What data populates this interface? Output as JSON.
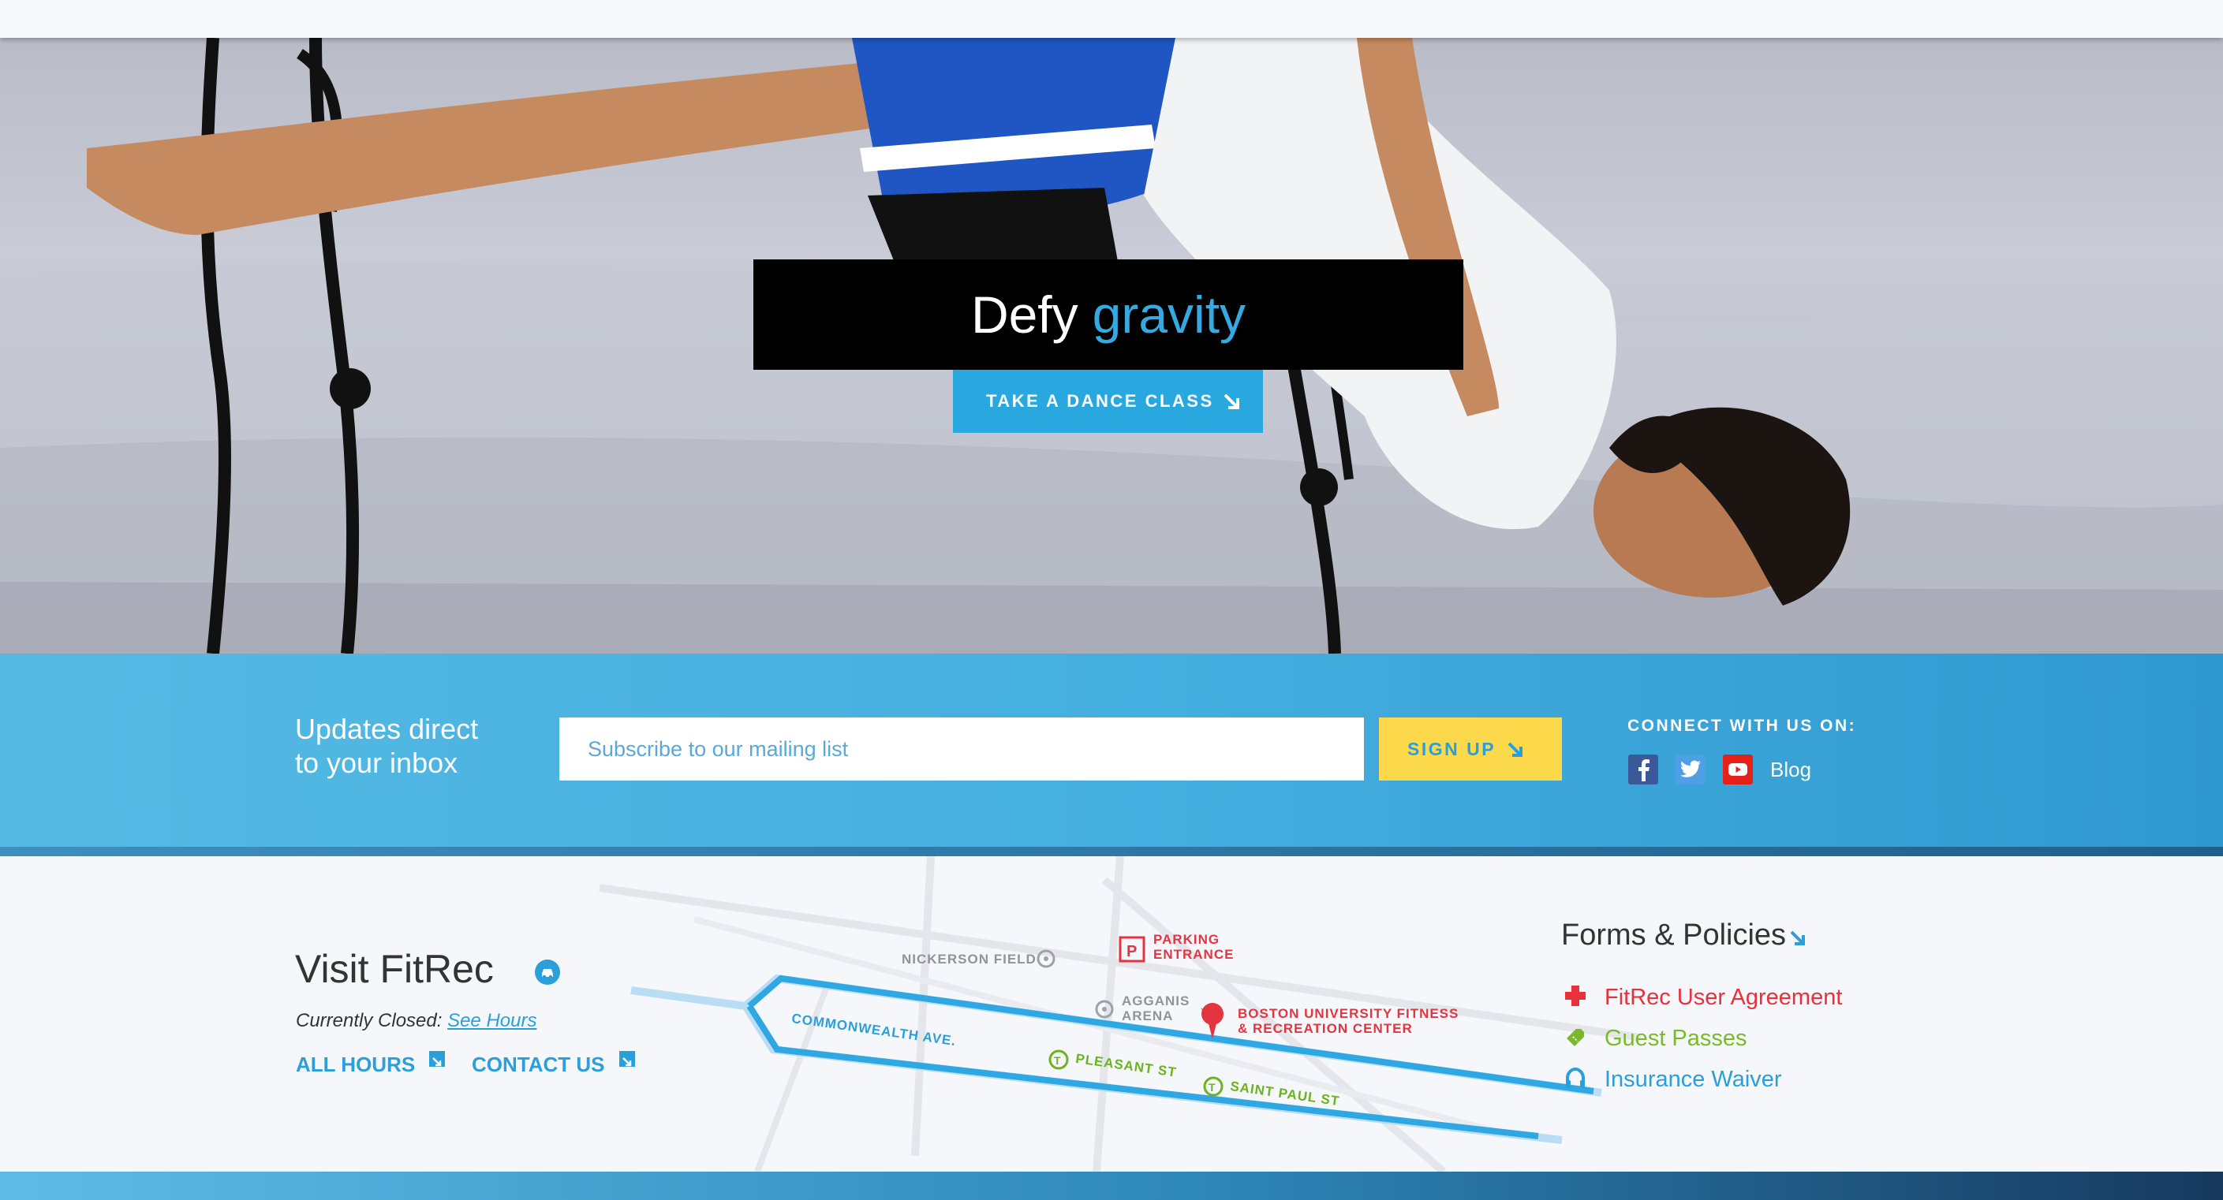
{
  "hero": {
    "headline_part1": "Defy",
    "headline_part2": "gravity",
    "cta_label": "TAKE A DANCE CLASS"
  },
  "newsletter": {
    "heading_line1": "Updates direct",
    "heading_line2": "to your inbox",
    "placeholder": "Subscribe to our mailing list",
    "button_label": "SIGN UP",
    "connect_label": "CONNECT WITH US ON:",
    "social": [
      "facebook-icon",
      "twitter-icon",
      "youtube-icon"
    ],
    "blog_label": "Blog"
  },
  "visit": {
    "title": "Visit FitRec",
    "status_prefix": "Currently Closed:",
    "see_hours_label": "See Hours",
    "all_hours_label": "ALL HOURS",
    "contact_label": "CONTACT US"
  },
  "map": {
    "nickerson": "NICKERSON FIELD",
    "parking_line1": "PARKING",
    "parking_line2": "ENTRANCE",
    "agganis_line1": "AGGANIS",
    "agganis_line2": "ARENA",
    "bu_line1": "BOSTON UNIVERSITY FITNESS",
    "bu_line2": "& RECREATION CENTER",
    "commonwealth": "COMMONWEALTH AVE.",
    "pleasant": "PLEASANT ST",
    "saint_paul": "SAINT PAUL ST"
  },
  "forms": {
    "title": "Forms & Policies",
    "items": [
      {
        "label": "FitRec User Agreement",
        "color": "#e8313a",
        "icon": "medical-cross-icon"
      },
      {
        "label": "Guest Passes",
        "color": "#7ab929",
        "icon": "ticket-icon"
      },
      {
        "label": "Insurance Waiver",
        "color": "#2a9fd9",
        "icon": "headphones-icon"
      }
    ]
  },
  "colors": {
    "accent_blue": "#29a8e0",
    "signup_yellow": "#fcd94a",
    "headline_bg": "#000000"
  }
}
